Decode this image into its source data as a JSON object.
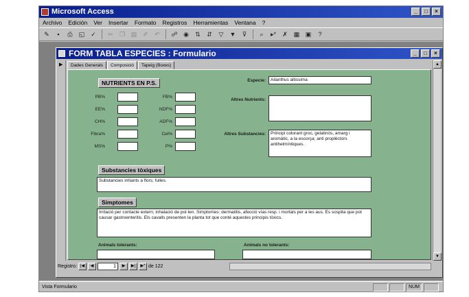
{
  "app": {
    "title": "Microsoft Access"
  },
  "window_buttons": [
    "_",
    "□",
    "×"
  ],
  "menu": [
    "Archivo",
    "Edición",
    "Ver",
    "Insertar",
    "Formato",
    "Registros",
    "Herramientas",
    "Ventana",
    "?"
  ],
  "form": {
    "title": "FORM TABLA ESPECIES : Formulario",
    "tabs": [
      "Dades Generals",
      "Composició",
      "Tapeig (Boxes)"
    ],
    "active_tab": "Composició"
  },
  "composicio": {
    "nutrients_heading": "NUTRIENTS EN P.S.",
    "nutrients_left": [
      {
        "label": "PB%",
        "value": ""
      },
      {
        "label": "EE%",
        "value": ""
      },
      {
        "label": "CH%",
        "value": ""
      },
      {
        "label": "Fibra%",
        "value": ""
      },
      {
        "label": "MS%",
        "value": ""
      }
    ],
    "nutrients_right": [
      {
        "label": "FB%",
        "value": ""
      },
      {
        "label": "NDF%",
        "value": ""
      },
      {
        "label": "ADF%",
        "value": ""
      },
      {
        "label": "Cel%",
        "value": ""
      },
      {
        "label": "P%",
        "value": ""
      }
    ],
    "especie_label": "Especie:",
    "especie_value": "Ailanthus altissima",
    "altres_nutrients_label": "Altres Nutrients:",
    "altres_nutrients_value": "",
    "altres_substancies_label": "Altres Substancies:",
    "altres_substancies_value": "Principi colorant groc, gelatinós, amarg i aromàtic, a la escorça; anti proplèctors antihelmíntiques.",
    "toxiques_heading": "Substancies tòxiques",
    "toxiques_value": "Substancies irritants a flors; fulles.",
    "simptomes_heading": "Simptomes",
    "simptomes_value": "Irritació per contacte extern; inhalació de pol·len. Simptomes: dermatitis, afecció vías resp. i mortals per a les aus. Es sospita que pot causar gastroenteritis. Els cavalls presenten la planta tot que conté aquestes principis tòxics.",
    "animals_tolerants_label": "Animals tolerants:",
    "animals_no_tolerants_label": "Animals no tolerants:"
  },
  "navigation": {
    "label": "Registro:",
    "current": "1",
    "total_text": "de 122"
  },
  "status": {
    "text": "Vista Formulario",
    "indicator": "NUM"
  },
  "colors": {
    "title_bar": "#0a1e8c",
    "form_background": "#86b38d",
    "chrome": "#c0c0c0"
  }
}
